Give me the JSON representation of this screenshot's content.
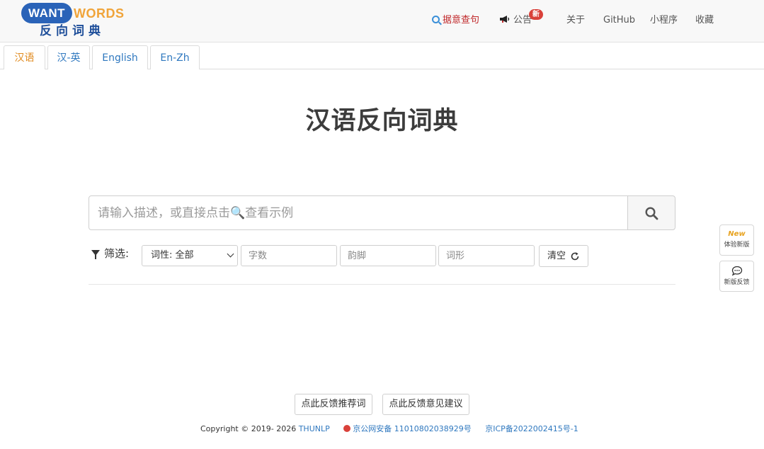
{
  "header": {
    "logo": {
      "part1": "WANT",
      "part2": "WORDS",
      "chinese": "反向词典"
    },
    "nav": {
      "search_sentence": "据意查句",
      "notice": "公告",
      "notice_badge": "新",
      "about": "关于",
      "github": "GitHub",
      "mini_program": "小程序",
      "favorites": "收藏"
    }
  },
  "tabs": [
    {
      "label": "汉语",
      "active": true
    },
    {
      "label": "汉-英",
      "active": false
    },
    {
      "label": "English",
      "active": false
    },
    {
      "label": "En-Zh",
      "active": false
    }
  ],
  "main": {
    "title": "汉语反向词典",
    "search": {
      "placeholder": "请输入描述，或直接点击🔍查看示例",
      "value": ""
    },
    "filter": {
      "label": "筛选:",
      "pos_select": "词性: 全部",
      "char_count_placeholder": "字数",
      "rhyme_placeholder": "韵脚",
      "form_placeholder": "词形",
      "clear_label": "清空"
    }
  },
  "side": {
    "new_version_icon": "New",
    "new_version_label": "体验新版",
    "feedback_label": "新版反馈"
  },
  "bottom": {
    "feedback_words": "点此反馈推荐词",
    "feedback_suggest": "点此反馈意见建议",
    "copyright": "Copyright © 2019- 2026",
    "thunlp": "THUNLP",
    "police_record": "京公网安备 11010802038929号",
    "icp": "京ICP备2022002415号-1"
  },
  "colors": {
    "brand_blue": "#2a63b8",
    "brand_orange": "#f0a43a",
    "link_blue": "#2f78bf",
    "active_tab": "#e08a1e",
    "accent_red": "#c0282a"
  }
}
